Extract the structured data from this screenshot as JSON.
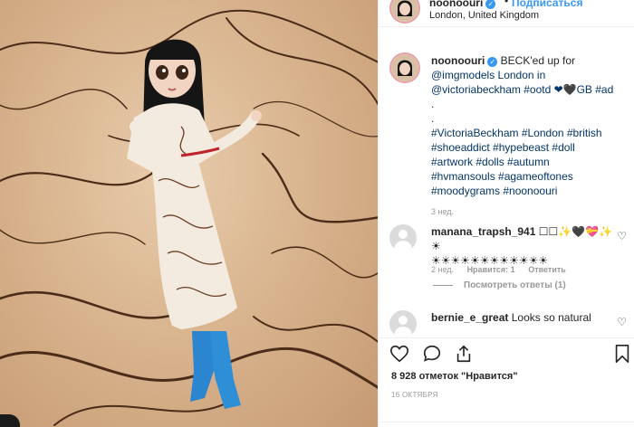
{
  "post": {
    "username": "noonoouri",
    "follow_label": "Подписаться",
    "location": "London, United Kingdom"
  },
  "caption": {
    "username": "noonoouri",
    "lines": [
      "BECK'ed up for",
      "@imgmodels London in",
      "@victoriabeckham #ootd ❤🖤GB #ad",
      ".",
      ".",
      "#VictoriaBeckham #London #british",
      "#shoeaddict #hypebeast #doll",
      "#artwork #dolls #autumn",
      "#hvmansouls #agameoftones",
      "#moodygrams #noonoouri"
    ],
    "time": "3 нед."
  },
  "comments": [
    {
      "username": "manana_trapsh_941",
      "text_line1": "☐☐✨🖤💝✨☀",
      "text_line2": "☀☀☀☀☀☀☀☀☀☀☀☀",
      "time": "2 нед.",
      "likes": "Нравится: 1",
      "reply": "Ответить",
      "view_replies": "Посмотреть ответы (1)"
    },
    {
      "username": "bernie_e_great",
      "text_line1": "Looks so natural"
    }
  ],
  "stats": {
    "likes": "8 928 отметок \"Нравится\"",
    "date": "16 ОКТЯБРЯ"
  },
  "colors": {
    "accent": "#3897f0",
    "hashtag": "#003569",
    "muted": "#999999"
  }
}
